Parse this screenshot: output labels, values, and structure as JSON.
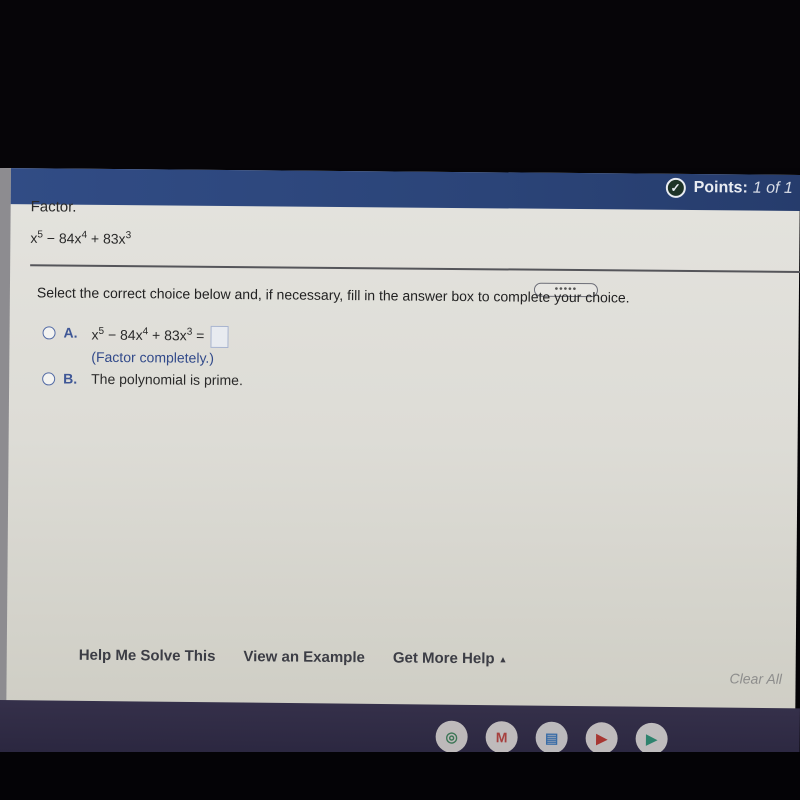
{
  "header": {
    "points_label": "Points:",
    "points_value": "1 of 1",
    "check_icon": "✓"
  },
  "question": {
    "label": "Factor.",
    "expression": {
      "t1_base": "x",
      "t1_exp": "5",
      "op1": " − 84x",
      "t2_exp": "4",
      "op2": " + 83x",
      "t3_exp": "3"
    }
  },
  "expander": {
    "label": "•••••"
  },
  "instruction": "Select the correct choice below and, if necessary, fill in the answer box to complete your choice.",
  "choices": [
    {
      "letter": "A.",
      "expr": {
        "t1_base": "x",
        "t1_exp": "5",
        "op1": " − 84x",
        "t2_exp": "4",
        "op2": " + 83x",
        "t3_exp": "3",
        "eq": " ="
      },
      "hint": "(Factor completely.)",
      "answer_value": ""
    },
    {
      "letter": "B.",
      "text": "The polynomial is prime."
    }
  ],
  "help": {
    "help_me_solve": "Help Me Solve This",
    "view_example": "View an Example",
    "get_more_help": "Get More Help",
    "caret": "▲",
    "clear_all": "Clear All"
  },
  "shelf": {
    "apps": [
      {
        "name": "chrome",
        "glyph": "◎",
        "bg": "#e6e2dc",
        "fg": "#3f8a5a"
      },
      {
        "name": "gmail",
        "glyph": "M",
        "bg": "#e8e4de",
        "fg": "#c8463d"
      },
      {
        "name": "docs",
        "glyph": "▤",
        "bg": "#e3e2de",
        "fg": "#3b7fc2"
      },
      {
        "name": "youtube",
        "glyph": "▶",
        "bg": "#e8e4de",
        "fg": "#c93a2e"
      },
      {
        "name": "play-store",
        "glyph": "▶",
        "bg": "#e8e6e0",
        "fg": "#2e9c7a"
      }
    ]
  }
}
